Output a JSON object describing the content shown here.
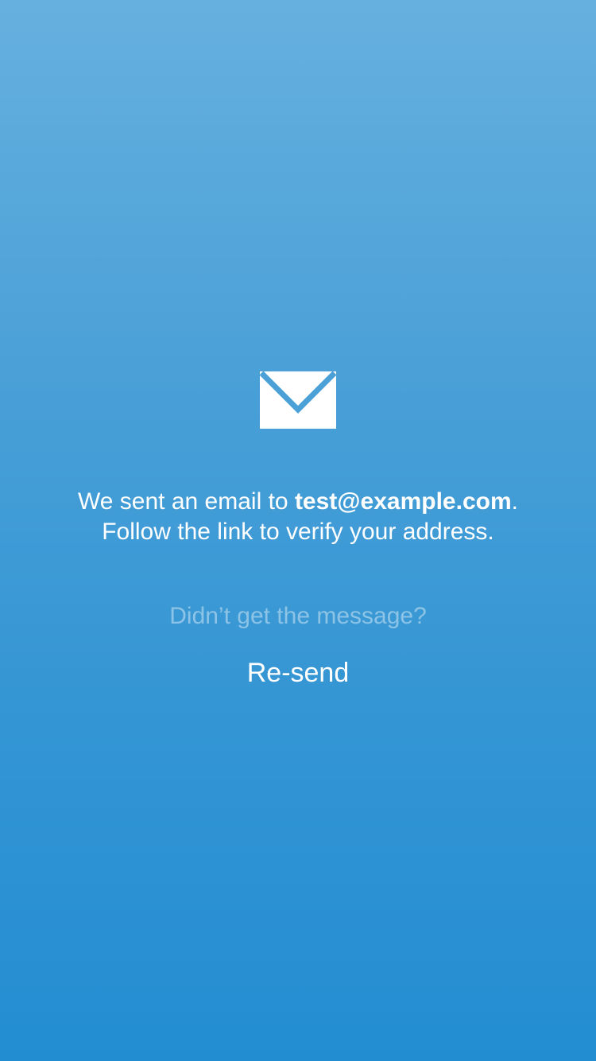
{
  "icon": "envelope-icon",
  "message": {
    "prefix": "We sent an email to ",
    "email": "test@example.com",
    "suffix": ".",
    "line2": "Follow the link to verify your address."
  },
  "hint": "Didn’t get the message?",
  "resend_label": "Re-send",
  "colors": {
    "gradient_top": "#66b0df",
    "gradient_bottom": "#238dd2",
    "text": "#ffffff"
  }
}
